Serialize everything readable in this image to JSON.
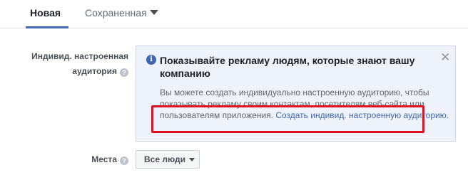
{
  "tabs": [
    {
      "label": "Новая",
      "active": true
    },
    {
      "label": "Сохраненная",
      "active": false
    }
  ],
  "audience_field": {
    "label_line1": "Индивид. настроенная",
    "label_line2": "аудитория",
    "help_icon": "question-icon"
  },
  "info_box": {
    "icon": "info-icon",
    "title": "Показывайте рекламу людям, которые знают вашу компанию",
    "body_text": "Вы можете создать индивидуально настроенную аудиторию, чтобы показывать рекламу своим контактам, посетителям веб-сайта или пользователям приложения. ",
    "link_text": "Создать индивид. настроенную аудиторию.",
    "close_icon": "close-icon"
  },
  "places_field": {
    "label": "Места",
    "help_icon": "question-icon",
    "selected_value": "Все люди"
  },
  "colors": {
    "accent": "#4267b2",
    "highlight_border": "#e0101e",
    "info_bg": "#eef2fa"
  }
}
